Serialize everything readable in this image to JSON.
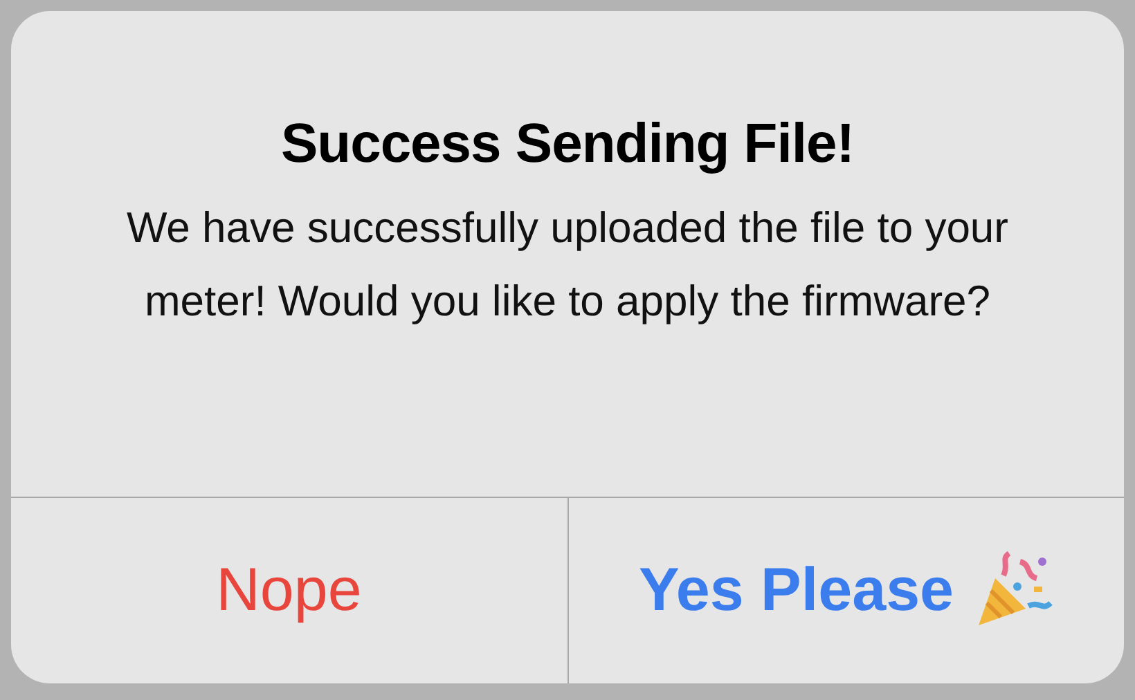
{
  "dialog": {
    "title": "Success Sending File!",
    "message": "We have successfully uploaded the file to your meter! Would you like to apply the firmware?",
    "buttons": [
      {
        "label": "Nope",
        "kind": "cancel"
      },
      {
        "label": "Yes Please",
        "kind": "confirm"
      }
    ]
  }
}
